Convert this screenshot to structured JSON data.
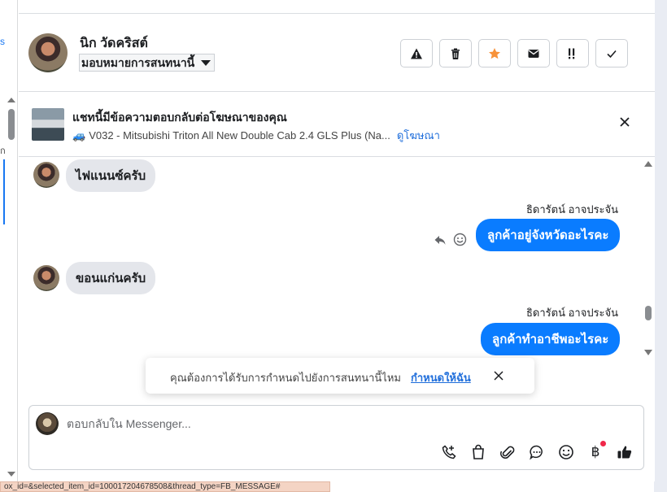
{
  "contact": {
    "name": "นิก วัดคริสต์",
    "assign_label": "มอบหมายการสนทนานี้"
  },
  "actions": [
    {
      "name": "spam-warning-icon"
    },
    {
      "name": "trash-icon"
    },
    {
      "name": "star-icon",
      "color": "#f7923a"
    },
    {
      "name": "mail-icon"
    },
    {
      "name": "follow-up-icon"
    },
    {
      "name": "done-check-icon"
    }
  ],
  "ad": {
    "title": "แชทนี้มีข้อความตอบกลับต่อโฆษณาของคุณ",
    "subtitle": "V032 - Mitsubishi Triton All New Double Cab 2.4 GLS Plus (Na...",
    "link": "ดูโฆษณา"
  },
  "messages": [
    {
      "direction": "in",
      "text": "ไฟแนนซ์ครับ"
    },
    {
      "direction": "out",
      "sender": "ธิดารัตน์ อาจประจัน",
      "text": "ลูกค้าอยู่จังหวัดอะไรคะ"
    },
    {
      "direction": "in",
      "text": "ขอนแก่นครับ"
    },
    {
      "direction": "out",
      "sender": "ธิดารัตน์ อาจประจัน",
      "text": "ลูกค้าทำอาชีพอะไรคะ"
    }
  ],
  "toast": {
    "text": "คุณต้องการได้รับการกำหนดไปยังการสนทนานี้ไหม",
    "link": "กำหนดให้ฉัน"
  },
  "composer": {
    "placeholder": "ตอบกลับใน Messenger...",
    "baht_symbol": "฿"
  },
  "statusbar": {
    "url": "ox_id=&selected_item_id=100017204678508&thread_type=FB_MESSAGE#"
  },
  "colors": {
    "accent": "#0a7cff",
    "link": "#216fdb",
    "star": "#f7923a"
  }
}
